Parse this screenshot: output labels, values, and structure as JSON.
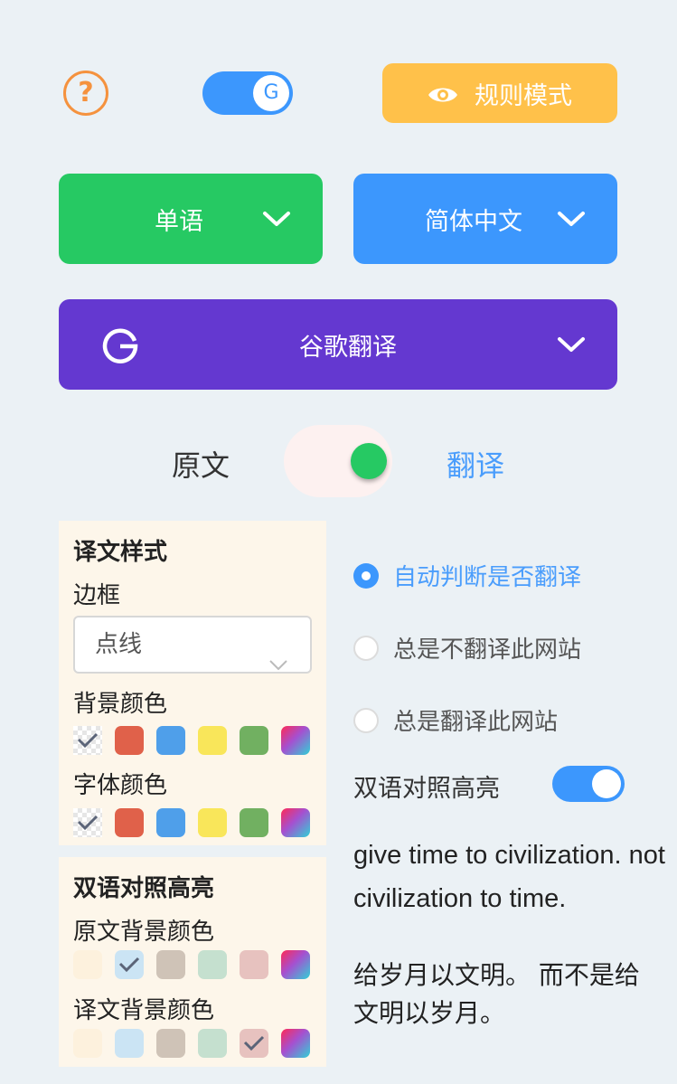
{
  "top": {
    "help_glyph": "?",
    "g_toggle_glyph": "G",
    "rule_mode_label": "规则模式"
  },
  "dropdowns": {
    "mode": "单语",
    "language": "简体中文",
    "engine": "谷歌翻译"
  },
  "toggle": {
    "original_label": "原文",
    "translated_label": "翻译"
  },
  "style_panel": {
    "title": "译文样式",
    "border_label": "边框",
    "border_value": "点线",
    "bg_color_label": "背景颜色",
    "font_color_label": "字体颜色",
    "palette": [
      "none",
      "#e0614a",
      "#4f9fea",
      "#f9e65a",
      "#71b061",
      "gradient"
    ]
  },
  "bilingual_panel": {
    "title": "双语对照高亮",
    "orig_bg_label": "原文背景颜色",
    "trans_bg_label": "译文背景颜色",
    "palette": [
      "#fdf1dd",
      "#cbe4f4",
      "#cfc3b7",
      "#c5e0cf",
      "#e7c2bf",
      "gradient"
    ]
  },
  "options": {
    "auto": "自动判断是否翻译",
    "never": "总是不翻译此网站",
    "always": "总是翻译此网站"
  },
  "bilingual_highlight_label": "双语对照高亮",
  "preview": {
    "english": "give time to civilization. not civilization to time.",
    "chinese": "给岁月以文明。 而不是给文明以岁月。"
  }
}
